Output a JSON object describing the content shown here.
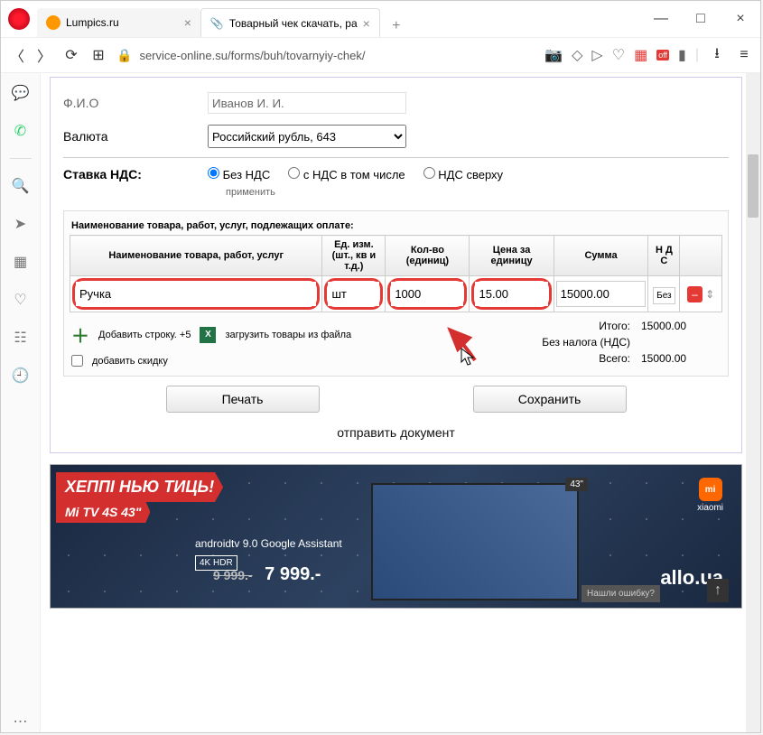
{
  "window": {
    "tab1_title": "Lumpics.ru",
    "tab2_title": "Товарный чек скачать, ра",
    "min": "—",
    "max": "□",
    "close": "×",
    "add": "+"
  },
  "addr": {
    "url": "service-online.su/forms/buh/tovarnyiy-chek/"
  },
  "form": {
    "fio_label": "Ф.И.О",
    "fio_value": "Иванов И. И.",
    "currency_label": "Валюта",
    "currency_value": "Российский рубль, 643",
    "nds_label": "Ставка НДС:",
    "nds_opts": {
      "a": "Без НДС",
      "b": "с НДС в том числе",
      "c": "НДС сверху"
    },
    "apply": "применить"
  },
  "table": {
    "title": "Наименование товара, работ, услуг, подлежащих оплате:",
    "h_name": "Наименование товара, работ, услуг",
    "h_unit": "Ед. изм. (шт., кв и т.д.)",
    "h_qty": "Кол-во (единиц)",
    "h_price": "Цена за единицу",
    "h_sum": "Сумма",
    "h_nds": "Н Д С",
    "row": {
      "name": "Ручка",
      "unit": "шт",
      "qty": "1000",
      "price": "15.00",
      "sum": "15000.00",
      "nds": "Без"
    }
  },
  "actions": {
    "add_row": "Добавить строку. +5",
    "load_file": "загрузить товары из файла",
    "discount": "добавить скидку"
  },
  "totals": {
    "itogo_lbl": "Итого:",
    "itogo": "15000.00",
    "nalogi_lbl": "Без налога (НДС)",
    "vsego_lbl": "Всего:",
    "vsego": "15000.00"
  },
  "buttons": {
    "print": "Печать",
    "save": "Сохранить",
    "send": "отправить документ"
  },
  "banner": {
    "line1": "ХЕППІ НЬЮ ТИЦЬ!",
    "line2": "Mi TV 4S 43\"",
    "tech1": "androidtv 9.0  Google Assistant",
    "k4": "4K HDR",
    "old_price": "9 999.-",
    "price": "7 999.-",
    "brand": "xiaomi",
    "mi": "mi",
    "allo": "allo.ua",
    "tv43": "43\"",
    "feedback": "Нашли ошибку?"
  }
}
